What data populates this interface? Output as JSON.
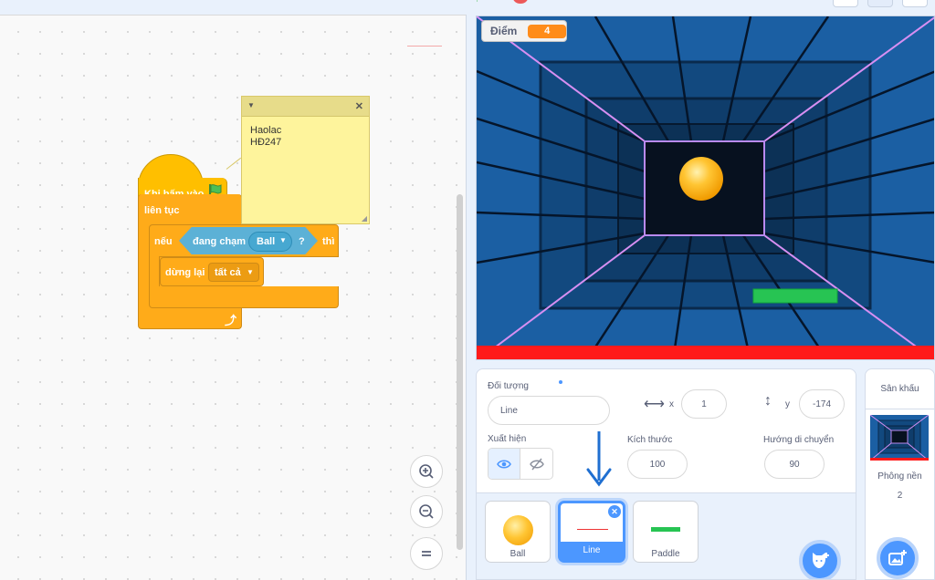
{
  "code": {
    "hat_label": "Khi bấm vào",
    "forever_label": "liên tục",
    "if_label": "nếu",
    "touching_label": "đang chạm",
    "touching_target": "Ball",
    "touching_suffix": "?",
    "then_label": "thì",
    "stop_label": "dừng lại",
    "stop_option": "tất cả",
    "note_text": "Haolac\nHĐ247",
    "note_close": "✕"
  },
  "stage": {
    "score_label": "Điểm",
    "score_value": "4"
  },
  "sprite_info": {
    "sprite_label": "Đối tượng",
    "sprite_name": "Line",
    "x_label": "x",
    "x_value": "1",
    "y_label": "y",
    "y_value": "-174",
    "show_label": "Xuất hiện",
    "size_label": "Kích thước",
    "size_value": "100",
    "direction_label": "Hướng di chuyển",
    "direction_value": "90"
  },
  "sprites": [
    {
      "name": "Ball"
    },
    {
      "name": "Line"
    },
    {
      "name": "Paddle"
    }
  ],
  "stage_panel": {
    "title": "Sân khấu",
    "backdrops_label": "Phông nền",
    "backdrops_count": "2"
  },
  "colors": {
    "motion_blue": "#4c97ff",
    "events_yellow": "#ffbf00",
    "control_orange": "#ffab19",
    "sensing_blue": "#5cb1d6",
    "selected_sprite": "#855cd6"
  }
}
